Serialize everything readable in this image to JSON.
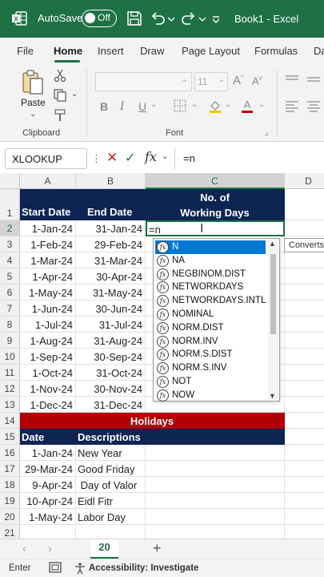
{
  "titlebar": {
    "autosave_label": "AutoSave",
    "autosave_state": "Off",
    "doc_title": "Book1  -  Excel",
    "bg_color": "#1e7145"
  },
  "tabs": [
    "File",
    "Home",
    "Insert",
    "Draw",
    "Page Layout",
    "Formulas",
    "Da"
  ],
  "active_tab": "Home",
  "ribbon": {
    "paste_label": "Paste",
    "clipboard_label": "Clipboard",
    "font_label": "Font",
    "font_size": "11"
  },
  "formula_bar": {
    "name_box": "XLOOKUP",
    "fx": "fx",
    "content": "=n"
  },
  "columns": [
    "A",
    "B",
    "C",
    "D"
  ],
  "rows": [
    "1",
    "2",
    "3",
    "4",
    "5",
    "6",
    "7",
    "8",
    "9",
    "10",
    "11",
    "12",
    "13",
    "14",
    "15",
    "16",
    "17",
    "18",
    "19",
    "20",
    "21"
  ],
  "sheet": {
    "header": {
      "start": "Start Date",
      "end": "End Date",
      "c_line1": "No. of",
      "c_line2": "Working Days"
    },
    "editing_cell": "=n",
    "dates": [
      {
        "start": "1-Jan-24",
        "end": "31-Jan-24"
      },
      {
        "start": "1-Feb-24",
        "end": "29-Feb-24"
      },
      {
        "start": "1-Mar-24",
        "end": "31-Mar-24"
      },
      {
        "start": "1-Apr-24",
        "end": "30-Apr-24"
      },
      {
        "start": "1-May-24",
        "end": "31-May-24"
      },
      {
        "start": "1-Jun-24",
        "end": "30-Jun-24"
      },
      {
        "start": "1-Jul-24",
        "end": "31-Jul-24"
      },
      {
        "start": "1-Aug-24",
        "end": "31-Aug-24"
      },
      {
        "start": "1-Sep-24",
        "end": "30-Sep-24"
      },
      {
        "start": "1-Oct-24",
        "end": "31-Oct-24"
      },
      {
        "start": "1-Nov-24",
        "end": "30-Nov-24"
      },
      {
        "start": "1-Dec-24",
        "end": "31-Dec-24"
      }
    ],
    "holidays_title": "Holidays",
    "holidays_header": {
      "date": "Date",
      "desc": "Descriptions"
    },
    "holidays": [
      {
        "date": "1-Jan-24",
        "desc": "New Year"
      },
      {
        "date": "29-Mar-24",
        "desc": "Good Friday"
      },
      {
        "date": "9-Apr-24",
        "desc": " Day of Valor"
      },
      {
        "date": "10-Apr-24",
        "desc": "Eidl Fitr"
      },
      {
        "date": "1-May-24",
        "desc": "Labor Day"
      }
    ],
    "navy": "#0e2452",
    "red": "#b00000"
  },
  "autocomplete": {
    "items": [
      "N",
      "NA",
      "NEGBINOM.DIST",
      "NETWORKDAYS",
      "NETWORKDAYS.INTL",
      "NOMINAL",
      "NORM.DIST",
      "NORM.INV",
      "NORM.S.DIST",
      "NORM.S.INV",
      "NOT",
      "NOW"
    ],
    "selected_index": 0,
    "tooltip": "Converts"
  },
  "sheet_tab": "20",
  "status": {
    "mode": "Enter",
    "accessibility": "Accessibility: Investigate"
  }
}
